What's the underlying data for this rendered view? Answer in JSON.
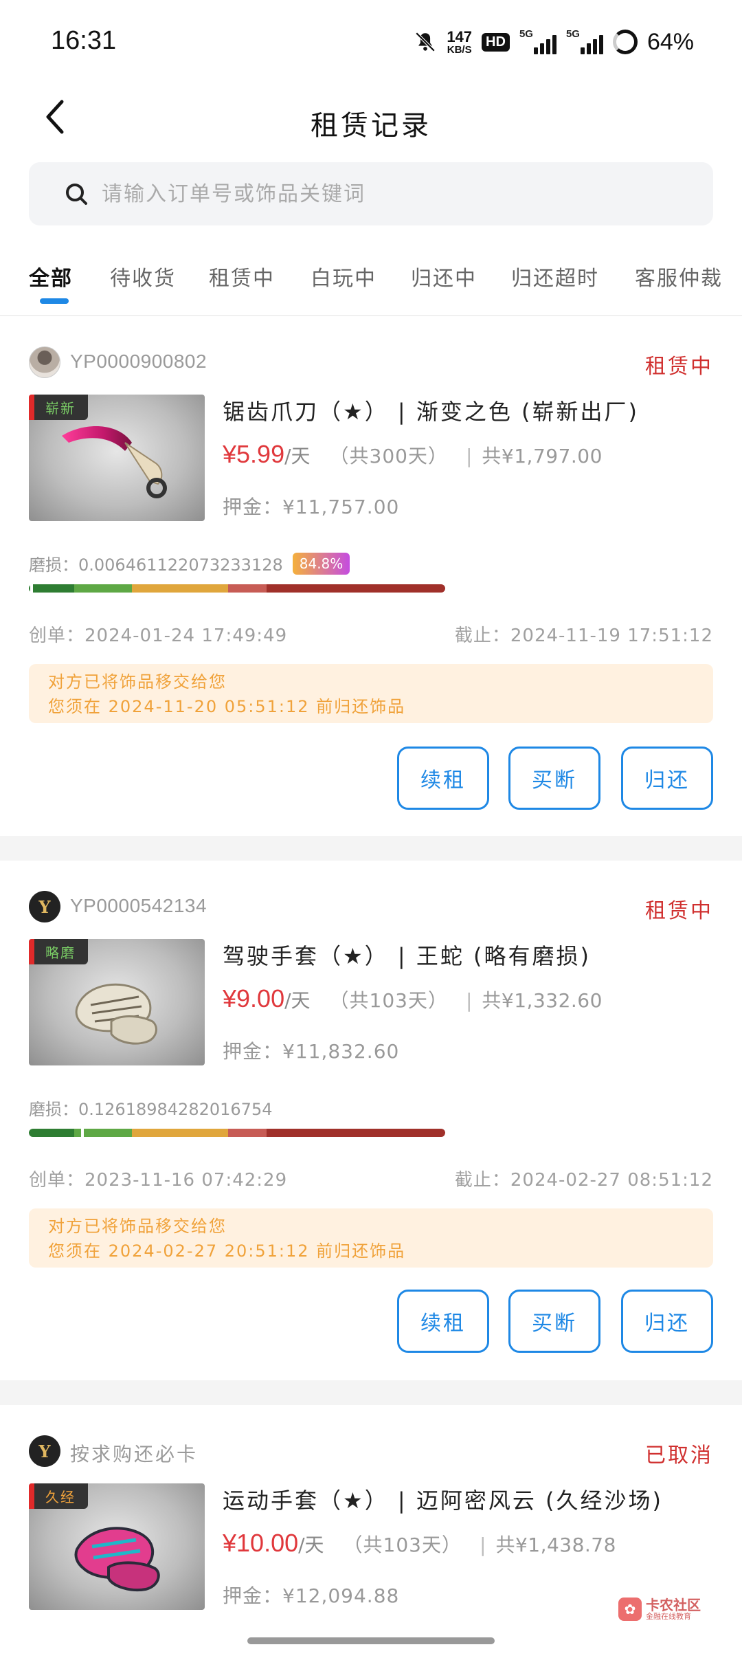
{
  "status_bar": {
    "time": "16:31",
    "speed_value": "147",
    "speed_unit": "KB/S",
    "hd_label": "HD",
    "net1": "5G",
    "net2": "5G",
    "battery": "64%"
  },
  "header": {
    "title": "租赁记录"
  },
  "search": {
    "placeholder": "请输入订单号或饰品关键词"
  },
  "tabs": [
    {
      "label": "全部",
      "active": true
    },
    {
      "label": "待收货"
    },
    {
      "label": "租赁中"
    },
    {
      "label": "白玩中"
    },
    {
      "label": "归还中"
    },
    {
      "label": "归还超时"
    },
    {
      "label": "客服仲裁"
    }
  ],
  "orders": [
    {
      "order_id": "YP0000900802",
      "status": "租赁中",
      "wear_tag": "崭新",
      "item_name": "锯齿爪刀（★） | 渐变之色 (崭新出厂)",
      "price": "¥5.99",
      "per_day": "/天",
      "days": "（共300天）",
      "separator": "|",
      "total": "共¥1,797.00",
      "deposit": "押金：¥11,757.00",
      "wear_value": "磨损：0.006461122073233128",
      "wear_percent": "84.8%",
      "created": "创单：2024-01-24 17:49:49",
      "deadline": "截止：2024-11-19 17:51:12",
      "notice_line1": "对方已将饰品移交给您",
      "notice_line2": "您须在 2024-11-20 05:51:12 前归还饰品",
      "buttons": [
        "续租",
        "买断",
        "归还"
      ]
    },
    {
      "order_id": "YP0000542134",
      "status": "租赁中",
      "wear_tag": "略磨",
      "item_name": "驾驶手套（★） | 王蛇 (略有磨损)",
      "price": "¥9.00",
      "per_day": "/天",
      "days": "（共103天）",
      "separator": "|",
      "total": "共¥1,332.60",
      "deposit": "押金：¥11,832.60",
      "wear_value": "磨损：0.12618984282016754",
      "created": "创单：2023-11-16 07:42:29",
      "deadline": "截止：2024-02-27 08:51:12",
      "notice_line1": "对方已将饰品移交给您",
      "notice_line2": "您须在 2024-02-27 20:51:12 前归还饰品",
      "buttons": [
        "续租",
        "买断",
        "归还"
      ]
    },
    {
      "order_id": "按求购还必卡",
      "status": "已取消",
      "wear_tag": "久经",
      "item_name": "运动手套（★） | 迈阿密风云 (久经沙场)",
      "price": "¥10.00",
      "per_day": "/天",
      "days": "（共103天）",
      "separator": "|",
      "total": "共¥1,438.78",
      "deposit": "押金：¥12,094.88"
    }
  ],
  "watermark": {
    "main": "卡农社区",
    "sub": "金融在线教育"
  },
  "colors": {
    "accent_blue": "#1e88e5",
    "status_red": "#d0302f",
    "price_red": "#e0383c",
    "notice_bg": "#fff1e0",
    "notice_text": "#f0a23a"
  },
  "icons": [
    "back-arrow-icon",
    "search-icon",
    "mute-bell-icon",
    "signal-icon",
    "battery-icon"
  ]
}
